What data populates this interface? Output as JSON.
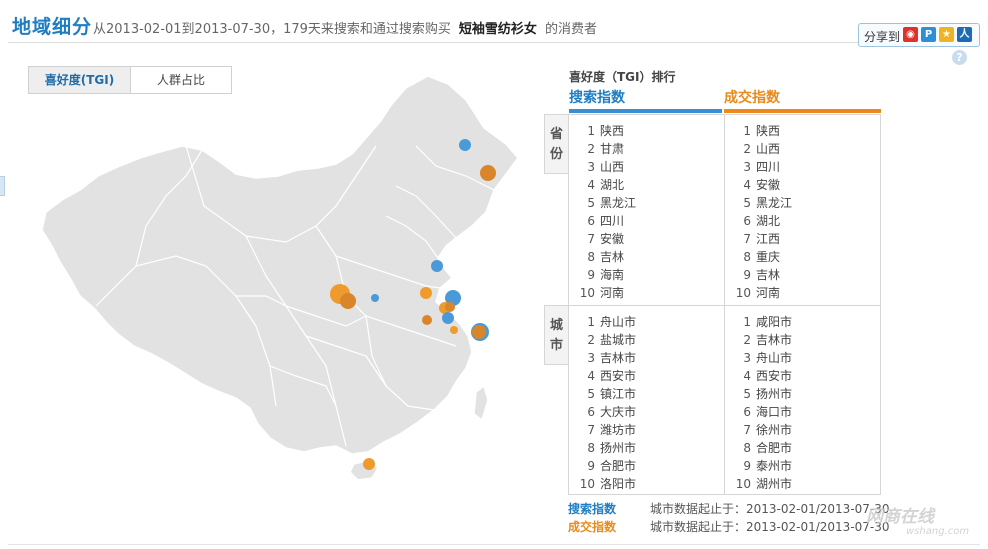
{
  "header": {
    "title": "地域细分",
    "subtitle_prefix": "从2013-02-01到2013-07-30，179天来搜索和通过搜索购买",
    "product": "短袖雪纺衫女",
    "subtitle_suffix": "的消费者"
  },
  "share": {
    "label": "分享到",
    "icons": [
      "weibo-icon",
      "p-icon",
      "qzone-icon",
      "renren-icon"
    ]
  },
  "tabs": [
    {
      "label": "喜好度(TGI)",
      "active": true
    },
    {
      "label": "人群占比",
      "active": false
    }
  ],
  "map": {
    "land_color": "#e2e2e2",
    "border_color": "#ffffff",
    "search_color": "#4a9ad8",
    "deal_color": "#ef9a2c"
  },
  "ranking": {
    "title": "喜好度（TGI）排行",
    "search_header": "搜索指数",
    "deal_header": "成交指数",
    "province_label": "省份",
    "city_label": "城市",
    "province_search": [
      {
        "rank": "1",
        "name": "陕西"
      },
      {
        "rank": "2",
        "name": "甘肃"
      },
      {
        "rank": "3",
        "name": "山西"
      },
      {
        "rank": "4",
        "name": "湖北"
      },
      {
        "rank": "5",
        "name": "黑龙江"
      },
      {
        "rank": "6",
        "name": "四川"
      },
      {
        "rank": "7",
        "name": "安徽"
      },
      {
        "rank": "8",
        "name": "吉林"
      },
      {
        "rank": "9",
        "name": "海南"
      },
      {
        "rank": "10",
        "name": "河南"
      }
    ],
    "province_deal": [
      {
        "rank": "1",
        "name": "陕西"
      },
      {
        "rank": "2",
        "name": "山西"
      },
      {
        "rank": "3",
        "name": "四川"
      },
      {
        "rank": "4",
        "name": "安徽"
      },
      {
        "rank": "5",
        "name": "黑龙江"
      },
      {
        "rank": "6",
        "name": "湖北"
      },
      {
        "rank": "7",
        "name": "江西"
      },
      {
        "rank": "8",
        "name": "重庆"
      },
      {
        "rank": "9",
        "name": "吉林"
      },
      {
        "rank": "10",
        "name": "河南"
      }
    ],
    "city_search": [
      {
        "rank": "1",
        "name": "舟山市"
      },
      {
        "rank": "2",
        "name": "盐城市"
      },
      {
        "rank": "3",
        "name": "吉林市"
      },
      {
        "rank": "4",
        "name": "西安市"
      },
      {
        "rank": "5",
        "name": "镇江市"
      },
      {
        "rank": "6",
        "name": "大庆市"
      },
      {
        "rank": "7",
        "name": "潍坊市"
      },
      {
        "rank": "8",
        "name": "扬州市"
      },
      {
        "rank": "9",
        "name": "合肥市"
      },
      {
        "rank": "10",
        "name": "洛阳市"
      }
    ],
    "city_deal": [
      {
        "rank": "1",
        "name": "咸阳市"
      },
      {
        "rank": "2",
        "name": "吉林市"
      },
      {
        "rank": "3",
        "name": "舟山市"
      },
      {
        "rank": "4",
        "name": "西安市"
      },
      {
        "rank": "5",
        "name": "扬州市"
      },
      {
        "rank": "6",
        "name": "海口市"
      },
      {
        "rank": "7",
        "name": "徐州市"
      },
      {
        "rank": "8",
        "name": "合肥市"
      },
      {
        "rank": "9",
        "name": "泰州市"
      },
      {
        "rank": "10",
        "name": "湖州市"
      }
    ],
    "footer": [
      {
        "label": "搜索指数",
        "text": "城市数据起止于：2013-02-01/2013-07-30",
        "color": "#1f7ec1"
      },
      {
        "label": "成交指数",
        "text": "城市数据起止于：2013-02-01/2013-07-30",
        "color": "#e88b1c"
      }
    ]
  },
  "watermark": {
    "text": "网商在线",
    "sub": "wshang.com"
  }
}
